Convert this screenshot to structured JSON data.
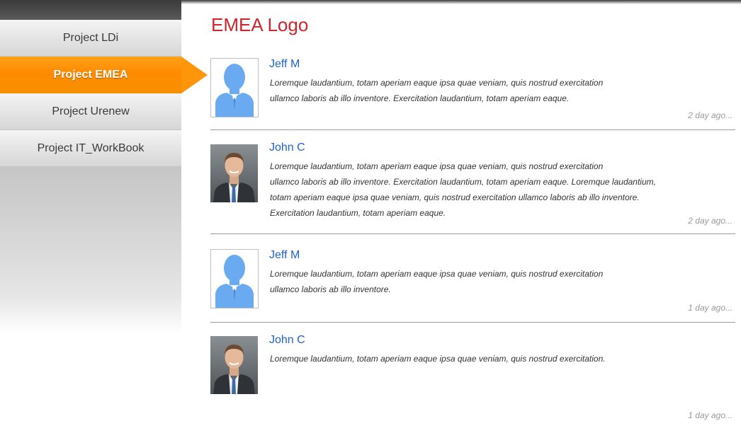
{
  "sidebar": {
    "items": [
      {
        "label": "Project LDi"
      },
      {
        "label": "Project EMEA"
      },
      {
        "label": "Project Urenew"
      },
      {
        "label": "Project IT_WorkBook"
      }
    ]
  },
  "header": {
    "title": "EMEA Logo"
  },
  "posts": [
    {
      "author": "Jeff M",
      "avatar": "silhouette-icon",
      "lines": [
        "Loremque laudantium, totam aperiam eaque ipsa quae veniam, quis nostrud exercitation",
        "ullamco laboris ab illo inventore. Exercitation laudantium, totam aperiam eaque."
      ],
      "time": "2 day ago..."
    },
    {
      "author": "John C",
      "avatar": "photo",
      "lines": [
        "Loremque laudantium, totam aperiam eaque ipsa quae veniam, quis nostrud exercitation",
        "ullamco laboris ab illo inventore. Exercitation laudantium, totam aperiam eaque. Loremque laudantium,",
        "totam aperiam eaque ipsa quae veniam, quis nostrud exercitation ullamco laboris ab illo inventore.",
        "Exercitation laudantium, totam aperiam eaque."
      ],
      "time": "2 day ago..."
    },
    {
      "author": "Jeff M",
      "avatar": "silhouette-icon",
      "lines": [
        "Loremque laudantium, totam aperiam eaque ipsa quae veniam, quis nostrud exercitation",
        "ullamco laboris ab illo inventore."
      ],
      "time": "1 day ago..."
    },
    {
      "author": "John C",
      "avatar": "photo",
      "lines": [
        "Loremque laudantium, totam aperiam eaque ipsa quae veniam, quis nostrud exercitation."
      ],
      "time": "1 day ago..."
    }
  ],
  "colors": {
    "accent": "#ff8a00",
    "title": "#d0242b",
    "author": "#1e63c8",
    "silhouette": "#6aaaf0"
  }
}
